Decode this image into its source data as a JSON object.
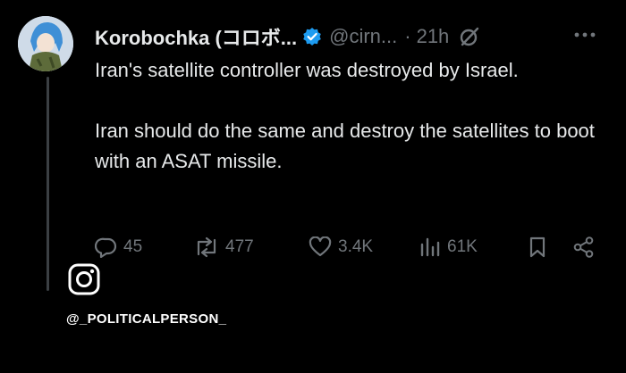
{
  "author": {
    "name": "Korobochka (コロボ...",
    "handle": "@cirn...",
    "separator": "·",
    "time": "21h"
  },
  "icons": {
    "verified": "verified-badge-icon",
    "grok": "grok-icon",
    "more": "more-options-icon",
    "reply": "reply-icon",
    "repost": "repost-icon",
    "like": "like-icon",
    "views": "views-icon",
    "bookmark": "bookmark-icon",
    "share": "share-icon",
    "instagram": "instagram-icon"
  },
  "tweet": {
    "paragraph_1": "Iran's satellite controller was destroyed by Israel.",
    "paragraph_2": "Iran should do the same and destroy the satellites to boot with an ASAT missile."
  },
  "actions": {
    "replies": "45",
    "reposts": "477",
    "likes": "3.4K",
    "views": "61K"
  },
  "watermark": {
    "credit": "@_POLITICALPERSON_"
  },
  "colors": {
    "background": "#000000",
    "text": "#e7e9ea",
    "muted": "#71767b",
    "verified": "#1d9bf0"
  }
}
